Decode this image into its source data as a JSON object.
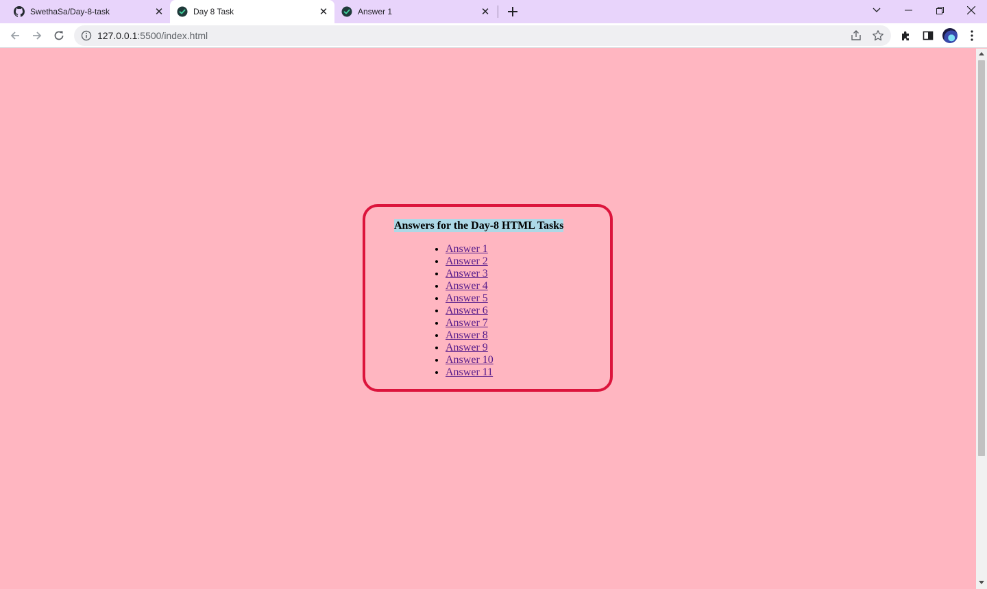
{
  "tabs": [
    {
      "title": "SwethaSa/Day-8-task",
      "icon": "github-icon",
      "active": false
    },
    {
      "title": "Day 8 Task",
      "icon": "check-circle-icon",
      "active": true
    },
    {
      "title": "Answer 1",
      "icon": "check-circle-icon",
      "active": false
    }
  ],
  "address_bar": {
    "host": "127.0.0.1",
    "path": ":5500/index.html"
  },
  "page": {
    "heading": "Answers for the Day-8 HTML Tasks",
    "links": [
      "Answer 1",
      "Answer 2",
      "Answer 3",
      "Answer 4",
      "Answer 5",
      "Answer 6",
      "Answer 7",
      "Answer 8",
      "Answer 9",
      "Answer 10",
      "Answer 11"
    ]
  },
  "colors": {
    "page_background": "#ffb6c1",
    "card_border": "#dc143c",
    "heading_highlight": "#add8e6",
    "visited_link": "#551a8b",
    "tab_strip": "#e8d4fb"
  }
}
